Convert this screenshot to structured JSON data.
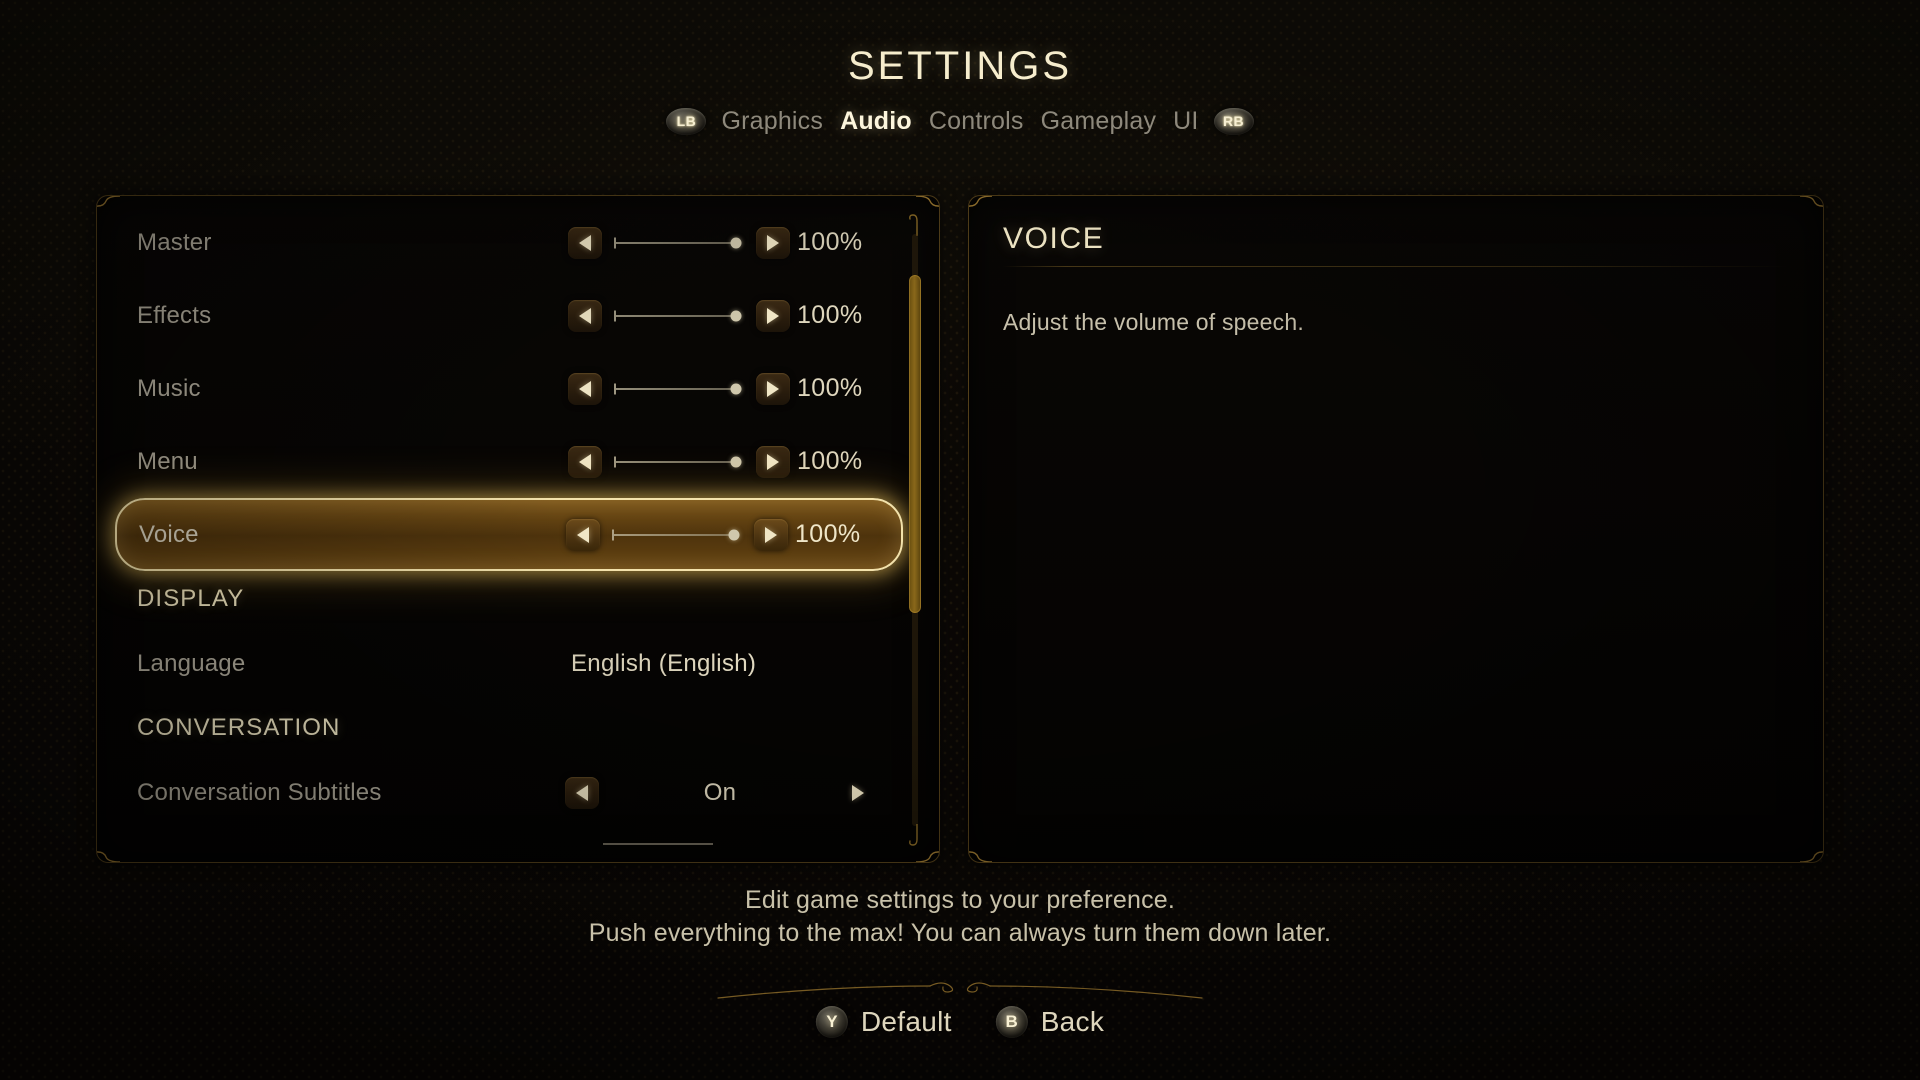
{
  "header": {
    "title": "SETTINGS",
    "left_bumper": "LB",
    "right_bumper": "RB",
    "tabs": [
      {
        "label": "Graphics",
        "active": false
      },
      {
        "label": "Audio",
        "active": true
      },
      {
        "label": "Controls",
        "active": false
      },
      {
        "label": "Gameplay",
        "active": false
      },
      {
        "label": "UI",
        "active": false
      }
    ]
  },
  "settings_list": [
    {
      "kind": "slider",
      "label": "Master",
      "value": "100%",
      "fill": 1.0,
      "selected": false
    },
    {
      "kind": "slider",
      "label": "Effects",
      "value": "100%",
      "fill": 1.0,
      "selected": false
    },
    {
      "kind": "slider",
      "label": "Music",
      "value": "100%",
      "fill": 1.0,
      "selected": false
    },
    {
      "kind": "slider",
      "label": "Menu",
      "value": "100%",
      "fill": 1.0,
      "selected": false
    },
    {
      "kind": "slider",
      "label": "Voice",
      "value": "100%",
      "fill": 1.0,
      "selected": true
    },
    {
      "kind": "section",
      "label": "DISPLAY"
    },
    {
      "kind": "value",
      "label": "Language",
      "value": "English (English)"
    },
    {
      "kind": "section",
      "label": "CONVERSATION"
    },
    {
      "kind": "option",
      "label": "Conversation Subtitles",
      "value": "On"
    }
  ],
  "detail": {
    "title": "VOICE",
    "description": "Adjust the volume of speech."
  },
  "hint": {
    "line1": "Edit game settings to your preference.",
    "line2": "Push everything to the max! You can always turn them down later."
  },
  "actions": [
    {
      "button": "Y",
      "label": "Default"
    },
    {
      "button": "B",
      "label": "Back"
    }
  ],
  "colors": {
    "accent_gold": "#f3e2ab",
    "text_cream": "#ded6bd",
    "text_muted": "#8e897c",
    "panel_border": "#92702c",
    "selected_fill": "#835a1a",
    "background": "#0d0a07"
  },
  "scroll": {
    "thumb_top_pct": 7,
    "thumb_height_pct": 57
  }
}
